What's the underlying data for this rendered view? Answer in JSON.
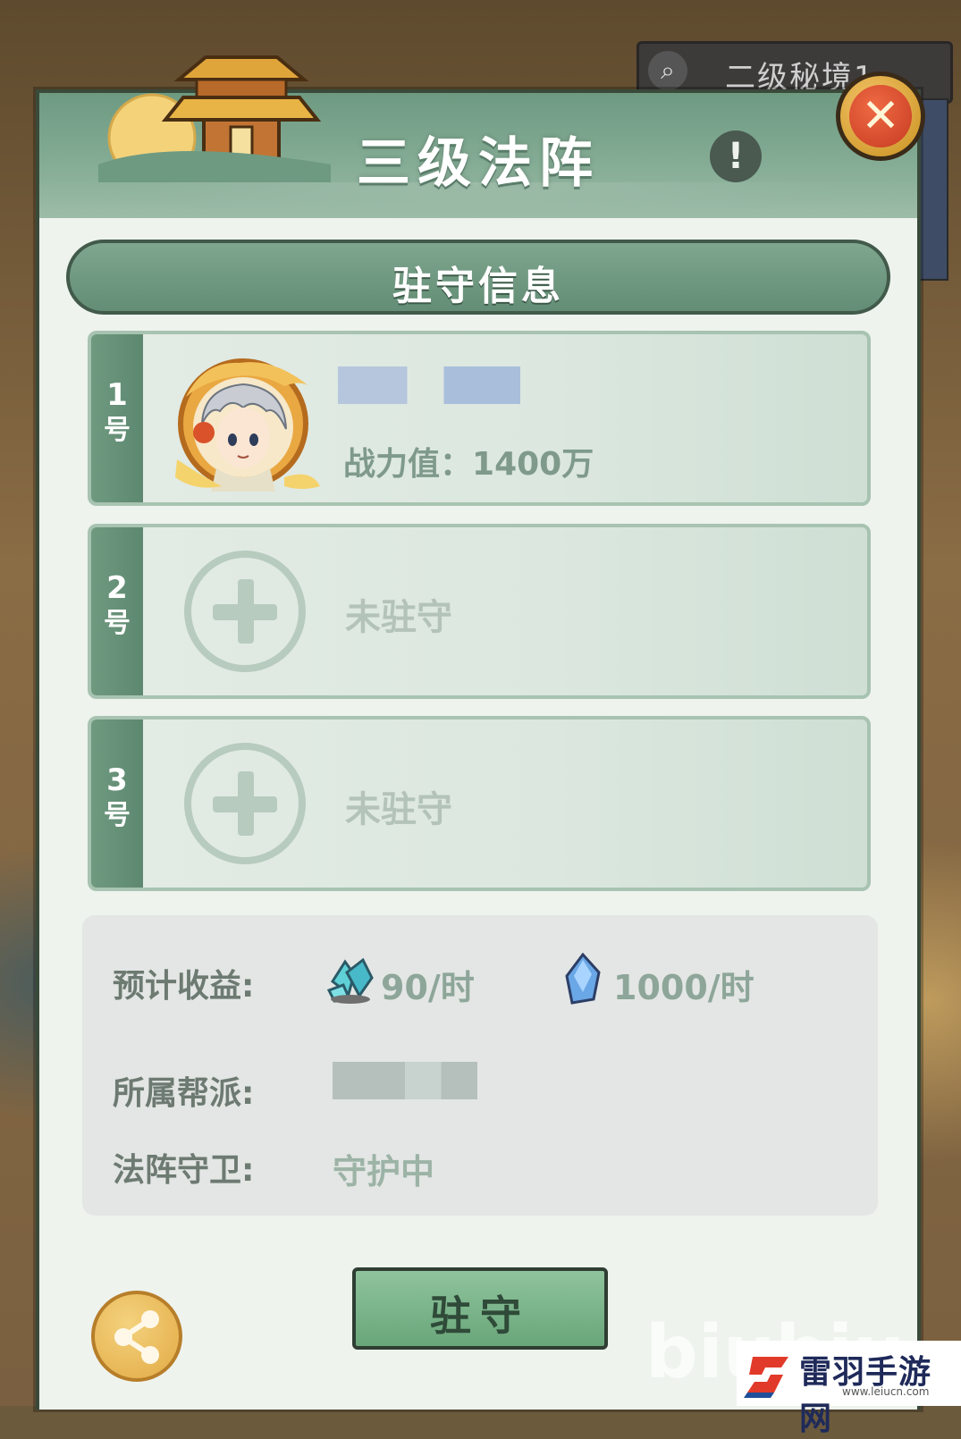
{
  "background": {
    "search_label": "二级秘境1",
    "search_icon": "magnifier-icon"
  },
  "header": {
    "title": "三级法阵",
    "info_icon": "!",
    "close_icon": "✕"
  },
  "section": {
    "title": "驻守信息"
  },
  "slots": [
    {
      "num": "1",
      "suffix": "号",
      "occupied": true,
      "power_label": "战力值：",
      "power_value": "1400万"
    },
    {
      "num": "2",
      "suffix": "号",
      "occupied": false,
      "empty_label": "未驻守"
    },
    {
      "num": "3",
      "suffix": "号",
      "occupied": false,
      "empty_label": "未驻守"
    }
  ],
  "info": {
    "income_label": "预计收益:",
    "income_rate_1": "90/时",
    "income_rate_2": "1000/时",
    "guild_label": "所属帮派:",
    "guard_label": "法阵守卫:",
    "guard_value": "守护中"
  },
  "actions": {
    "station_label": "驻守"
  },
  "watermark": "biubiu",
  "brand": {
    "name": "雷羽手游网",
    "url": "www.leiucn.com"
  },
  "colors": {
    "header_green": "#6e9a82",
    "panel_bg": "#eef3ee",
    "button_green": "#69a67a",
    "close_red": "#c63b22",
    "gold": "#e2aa44"
  }
}
